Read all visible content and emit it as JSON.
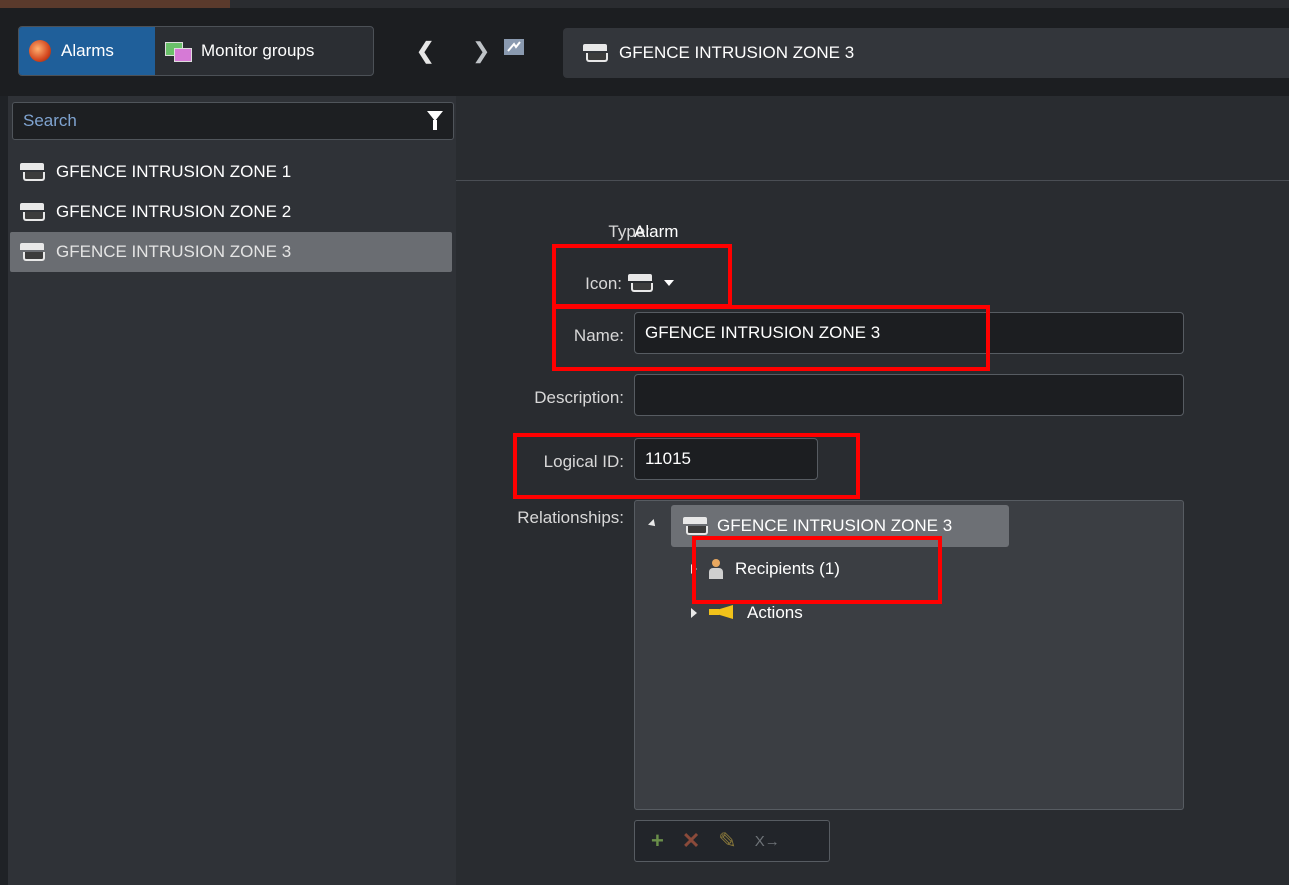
{
  "toolbar": {
    "tabs": [
      {
        "label": "Alarms",
        "icon": "alarm-icon"
      },
      {
        "label": "Monitor groups",
        "icon": "monitor-groups-icon"
      }
    ],
    "address": "GFENCE INTRUSION ZONE 3"
  },
  "sidebar": {
    "search_placeholder": "Search",
    "items": [
      {
        "label": "GFENCE INTRUSION ZONE 1"
      },
      {
        "label": "GFENCE INTRUSION ZONE 2"
      },
      {
        "label": "GFENCE INTRUSION ZONE 3",
        "selected": true
      }
    ]
  },
  "details": {
    "type_label": "Type:",
    "type_value": "Alarm",
    "icon_label": "Icon:",
    "name_label": "Name:",
    "name_value": "GFENCE INTRUSION ZONE 3",
    "description_label": "Description:",
    "description_value": "",
    "logical_id_label": "Logical ID:",
    "logical_id_value": "11015",
    "relationships_label": "Relationships:",
    "tree": {
      "root": "GFENCE INTRUSION ZONE 3",
      "children": [
        {
          "label": "Recipients (1)",
          "icon": "person-icon"
        },
        {
          "label": "Actions",
          "icon": "actions-icon"
        }
      ]
    },
    "relationship_tools": {
      "add": "+",
      "delete": "✕",
      "edit": "✎",
      "unlink": "X→"
    }
  },
  "colors": {
    "highlight": "#ff0000",
    "accent": "#1f5f9a"
  }
}
